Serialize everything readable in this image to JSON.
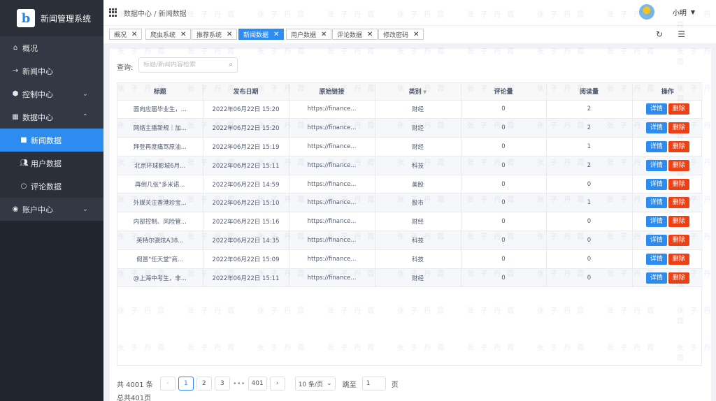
{
  "app": {
    "title": "新闻管理系统",
    "logo_letter": "b"
  },
  "sidebar": {
    "items": [
      {
        "label": "概况",
        "icon": "home-icon"
      },
      {
        "label": "新闻中心",
        "icon": "arrow-right-icon"
      },
      {
        "label": "控制中心",
        "icon": "cube-icon",
        "expanded": false
      },
      {
        "label": "数据中心",
        "icon": "table-icon",
        "expanded": true
      },
      {
        "label": "账户中心",
        "icon": "user-circle-icon",
        "expanded": false
      }
    ],
    "sub_items": [
      {
        "label": "新闻数据",
        "icon": "grid-icon",
        "active": true
      },
      {
        "label": "用户数据",
        "icon": "users-icon"
      },
      {
        "label": "评论数据",
        "icon": "comment-icon"
      }
    ]
  },
  "header": {
    "breadcrumb": "数据中心 / 新闻数据",
    "user_name": "小明"
  },
  "tabs": [
    {
      "label": "概况"
    },
    {
      "label": "爬虫系统"
    },
    {
      "label": "推荐系统"
    },
    {
      "label": "新闻数据",
      "active": true
    },
    {
      "label": "用户数据"
    },
    {
      "label": "评论数据"
    },
    {
      "label": "修改密码"
    }
  ],
  "search": {
    "label": "查询:",
    "placeholder": "标题/新闻内容检索"
  },
  "table": {
    "columns": [
      "标题",
      "发布日期",
      "原始链接",
      "类别",
      "评论量",
      "阅读量",
      "操作"
    ],
    "detail_label": "详情",
    "delete_label": "删除",
    "rows": [
      [
        "面向应届毕业生，...",
        "2022年06月22日 15:20",
        "https://finance...",
        "财经",
        "0",
        "2"
      ],
      [
        "网络主播新规｜加...",
        "2022年06月22日 15:20",
        "https://finance...",
        "财经",
        "0",
        "2"
      ],
      [
        "拜登再度痛骂原油...",
        "2022年06月22日 15:19",
        "https://finance...",
        "财经",
        "0",
        "1"
      ],
      [
        "北京环球影城6月...",
        "2022年06月22日 15:11",
        "https://finance...",
        "科技",
        "0",
        "2"
      ],
      [
        "再倒几张\"多米诺...",
        "2022年06月22日 14:59",
        "https://finance...",
        "美股",
        "0",
        "0"
      ],
      [
        "外媒关注香港珍宝...",
        "2022年06月22日 15:10",
        "https://finance...",
        "股市",
        "0",
        "1"
      ],
      [
        "内部控制、风险管...",
        "2022年06月22日 15:16",
        "https://finance...",
        "财经",
        "0",
        "0"
      ],
      [
        "英特尔骁炫A38...",
        "2022年06月22日 14:35",
        "https://finance...",
        "科技",
        "0",
        "0"
      ],
      [
        "假冒\"任天堂\"商...",
        "2022年06月22日 15:09",
        "https://finance...",
        "科技",
        "0",
        "0"
      ],
      [
        "@上海中考生，非...",
        "2022年06月22日 15:11",
        "https://finance...",
        "财经",
        "0",
        "0"
      ]
    ]
  },
  "pagination": {
    "total_text": "共 4001 条",
    "pages": [
      "1",
      "2",
      "3"
    ],
    "ellipsis": "•••",
    "last_page": "401",
    "page_size": "10 条/页",
    "jump_label": "跳至",
    "jump_value": "1",
    "page_unit": "页",
    "total_pages_text": "总共401页"
  },
  "watermark": "张 子 丹 霞"
}
